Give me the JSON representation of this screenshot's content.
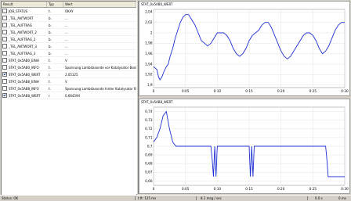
{
  "table": {
    "headers": [
      "Result",
      "Typ",
      "Wert"
    ],
    "rows": [
      {
        "checked": false,
        "name": "JOB_STATUS",
        "typ": "t.",
        "value": "OKAY"
      },
      {
        "checked": false,
        "name": "_TEL_ANTWORT",
        "typ": "b.",
        "value": "..."
      },
      {
        "checked": false,
        "name": "_TEL_AUFTRAG",
        "typ": "b.",
        "value": "..."
      },
      {
        "checked": false,
        "name": "_TEL_ANTWORT_2",
        "typ": "b.",
        "value": "..."
      },
      {
        "checked": false,
        "name": "_TEL_AUFTRAG_2",
        "typ": "b.",
        "value": "..."
      },
      {
        "checked": false,
        "name": "_TEL_ANTWORT_3",
        "typ": "b.",
        "value": "..."
      },
      {
        "checked": false,
        "name": "_TEL_AUFTRAG_3",
        "typ": "b.",
        "value": "..."
      },
      {
        "checked": false,
        "name": "STAT_0x5AB0_EINH",
        "typ": "t.",
        "value": "V"
      },
      {
        "checked": false,
        "name": "STAT_0x5AB0_INFO",
        "typ": "t.",
        "value": "Spannung Lambdasonde vor Katalysator Bank 2"
      },
      {
        "checked": true,
        "name": "STAT_0x5AB0_WERT",
        "typ": "r.",
        "value": "2.05125"
      },
      {
        "checked": false,
        "name": "STAT_0x5AB8_EINH",
        "typ": "t.",
        "value": "V"
      },
      {
        "checked": false,
        "name": "STAT_0x5AB8_INFO",
        "typ": "t.",
        "value": "Spannung Lambdasonde hinter Katalysator Bank 2"
      },
      {
        "checked": true,
        "name": "STAT_0x5AB8_WERT",
        "typ": "r.",
        "value": "0,664594"
      }
    ]
  },
  "status": {
    "left": "Status: OK",
    "middle": "t.ft: 125 ms",
    "middle2": "8.1 msg / sec",
    "right1": "0.0 s",
    "right2": "0 ms"
  },
  "colors": {
    "series": "#1f2fd6",
    "grid": "#e3e3e3"
  },
  "chart_data": [
    {
      "type": "line",
      "title": "STAT_0x5AB0_WERT",
      "xticks": [
        "0",
        "0:05",
        "0:10",
        "0:15",
        "0:20",
        "0:25",
        "0:30"
      ],
      "yticks": [
        "1,9",
        "1,92",
        "1,94",
        "1,96",
        "1,98",
        "2",
        "2,02",
        "2,04"
      ],
      "ylim": [
        1.895,
        2.045
      ],
      "xlim": [
        0,
        30
      ],
      "series": [
        {
          "x": [
            0,
            0.5,
            0.8,
            1.0,
            1.3,
            1.6,
            2.0,
            2.3,
            2.6,
            3.0,
            3.4,
            3.8,
            4.2,
            4.6,
            5.0,
            5.5,
            6.0,
            6.5,
            7.0,
            7.5,
            8.0,
            8.5,
            9.0,
            9.5,
            10.0,
            10.5,
            11.0,
            11.5,
            12.0,
            12.5,
            13.0,
            13.5,
            14.0,
            14.5,
            15.0,
            15.5,
            16.0,
            16.5,
            17.0,
            17.5,
            18.0,
            18.5,
            19.0,
            19.5,
            20.0,
            20.5,
            21.0,
            21.5,
            22.0,
            22.5,
            23.0,
            23.5,
            24.0,
            24.5,
            25.0,
            25.5,
            26.0,
            26.5,
            27.0,
            27.5,
            28.0,
            28.5,
            29.0,
            29.5,
            30.0
          ],
          "y": [
            1.935,
            1.93,
            1.915,
            1.91,
            1.915,
            1.925,
            1.935,
            1.94,
            1.955,
            1.97,
            1.99,
            2.005,
            2.02,
            2.03,
            2.035,
            2.035,
            2.025,
            2.015,
            2.0,
            1.985,
            1.98,
            1.975,
            1.98,
            1.99,
            2.0,
            2.0,
            2.0,
            1.995,
            1.985,
            1.97,
            1.96,
            1.955,
            1.96,
            1.97,
            1.985,
            1.995,
            2.0,
            2.005,
            2.015,
            2.02,
            2.02,
            2.01,
            1.995,
            1.98,
            1.965,
            1.955,
            1.95,
            1.955,
            1.965,
            1.975,
            1.985,
            1.995,
            2.0,
            2.0,
            1.995,
            1.985,
            1.97,
            1.96,
            1.965,
            1.975,
            1.99,
            2.005,
            2.015,
            2.02,
            2.02
          ]
        }
      ]
    },
    {
      "type": "line",
      "title": "STAT_0x5AB8_WERT",
      "xticks": [
        "0",
        "0:05",
        "0:10",
        "0:15",
        "0:20",
        "0:25",
        "0:30"
      ],
      "yticks": [
        "0,66",
        "0,67",
        "0,68",
        "0,69",
        "0,7",
        "0,71",
        "0,72",
        "0,73",
        "0,74"
      ],
      "ylim": [
        0.655,
        0.745
      ],
      "xlim": [
        0,
        30
      ],
      "series": [
        {
          "x": [
            0,
            0.5,
            1.0,
            1.5,
            2.0,
            2.5,
            3.0,
            3.5,
            4.0,
            5.0,
            6.0,
            7.0,
            8.0,
            9.0,
            9.2,
            9.4,
            9.6,
            9.8,
            10.0,
            11.0,
            12.0,
            13.0,
            14.0,
            15.0,
            15.2,
            15.4,
            15.6,
            15.8,
            16.0,
            17.0,
            18.0,
            19.0,
            20.0,
            21.0,
            22.0,
            23.0,
            24.0,
            25.0,
            25.5,
            26.0,
            26.5,
            27.0,
            27.2,
            27.4,
            27.6,
            28.0,
            29.0,
            30.0
          ],
          "y": [
            0.705,
            0.71,
            0.72,
            0.735,
            0.74,
            0.72,
            0.705,
            0.7,
            0.7,
            0.7,
            0.7,
            0.7,
            0.7,
            0.7,
            0.685,
            0.665,
            0.7,
            0.665,
            0.7,
            0.7,
            0.7,
            0.7,
            0.7,
            0.7,
            0.665,
            0.7,
            0.665,
            0.7,
            0.7,
            0.7,
            0.7,
            0.7,
            0.7,
            0.7,
            0.7,
            0.7,
            0.7,
            0.7,
            0.7,
            0.7,
            0.7,
            0.7,
            0.685,
            0.665,
            0.665,
            0.665,
            0.665,
            0.665
          ]
        }
      ]
    }
  ]
}
